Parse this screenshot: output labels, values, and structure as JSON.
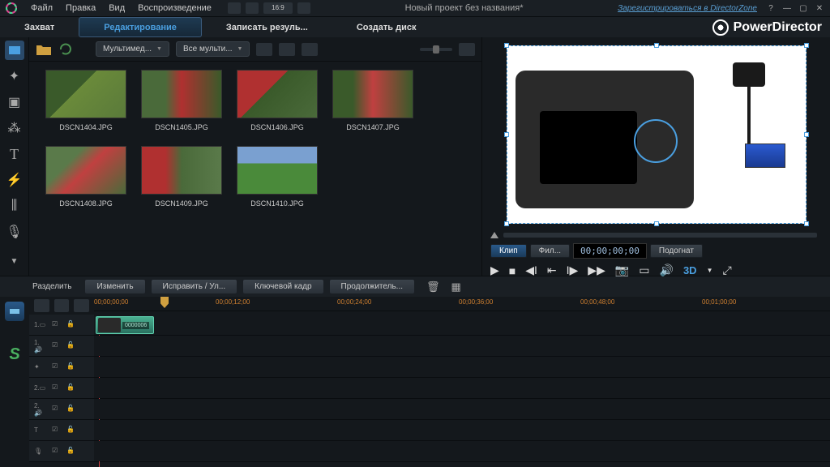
{
  "menu": {
    "file": "Файл",
    "edit": "Правка",
    "view": "Вид",
    "play": "Воспроизведение"
  },
  "project_title": "Новый проект без названия*",
  "directorzone": "Зарегистрироваться в DirectorZone",
  "brand": "PowerDirector",
  "aspect": "16:9",
  "tabs": {
    "capture": "Захват",
    "edit": "Редактирование",
    "produce": "Записать резуль...",
    "disc": "Создать диск"
  },
  "media_toolbar": {
    "dd1": "Мультимед...",
    "dd2": "Все мульти..."
  },
  "thumbs": [
    {
      "name": "DSCN1404.JPG",
      "cls": "g1"
    },
    {
      "name": "DSCN1405.JPG",
      "cls": "g2"
    },
    {
      "name": "DSCN1406.JPG",
      "cls": "g3"
    },
    {
      "name": "DSCN1407.JPG",
      "cls": "g4"
    },
    {
      "name": "DSCN1408.JPG",
      "cls": "g5"
    },
    {
      "name": "DSCN1409.JPG",
      "cls": "g6"
    },
    {
      "name": "DSCN1410.JPG",
      "cls": "g7"
    }
  ],
  "preview": {
    "clip": "Клип",
    "film": "Фил...",
    "tc": "00;00;00;00",
    "fit": "Подогнат",
    "threed": "3D"
  },
  "edit_toolbar": {
    "split": "Разделить",
    "modify": "Изменить",
    "fix": "Исправить / Ул...",
    "keyframe": "Ключевой кадр",
    "duration": "Продолжитель..."
  },
  "ruler": [
    "00;00;00;00",
    "00;00;12;00",
    "00;00;24;00",
    "00;00;36;00",
    "00;00;48;00",
    "00;01;00;00"
  ],
  "tracks": [
    {
      "n": "1.",
      "icon": "video"
    },
    {
      "n": "1.",
      "icon": "audio"
    },
    {
      "n": "",
      "icon": "fx"
    },
    {
      "n": "2.",
      "icon": "video"
    },
    {
      "n": "2.",
      "icon": "audio"
    },
    {
      "n": "",
      "icon": "title"
    },
    {
      "n": "",
      "icon": "voice"
    }
  ],
  "clip_tc": "0000006"
}
